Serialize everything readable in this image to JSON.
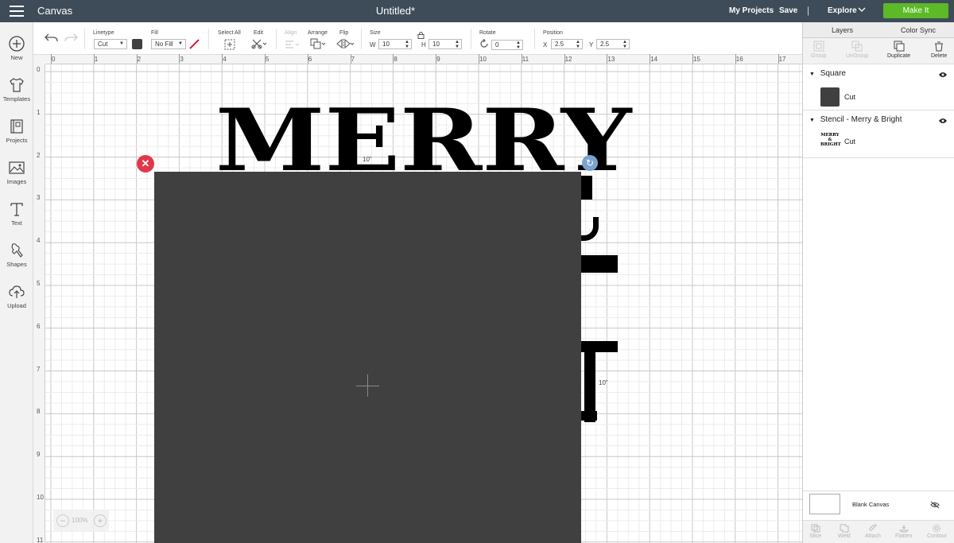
{
  "topbar": {
    "app_name": "Canvas",
    "doc_title": "Untitled*",
    "my_projects": "My Projects",
    "save": "Save",
    "separator": "|",
    "explore": "Explore",
    "make_it": "Make It",
    "make_it_color": "#5cb927"
  },
  "leftbar": {
    "items": [
      {
        "label": "New",
        "icon": "plus-circle-icon"
      },
      {
        "label": "Templates",
        "icon": "shirt-icon"
      },
      {
        "label": "Projects",
        "icon": "projects-icon"
      },
      {
        "label": "Images",
        "icon": "image-icon"
      },
      {
        "label": "Text",
        "icon": "text-icon"
      },
      {
        "label": "Shapes",
        "icon": "shapes-icon"
      },
      {
        "label": "Upload",
        "icon": "upload-cloud-icon"
      }
    ]
  },
  "toolbar": {
    "linetype_label": "Linetype",
    "linetype_value": "Cut",
    "fill_label": "Fill",
    "fill_value": "No Fill",
    "select_all_label": "Select All",
    "edit_label": "Edit",
    "align_label": "Align",
    "arrange_label": "Arrange",
    "flip_label": "Flip",
    "size_label": "Size",
    "w_label": "W",
    "w_value": "10",
    "h_label": "H",
    "h_value": "10",
    "rotate_label": "Rotate",
    "rotate_value": "0",
    "position_label": "Position",
    "x_label": "X",
    "x_value": "2.5",
    "y_label": "Y",
    "y_value": "2.5",
    "swatch_color": "#404040"
  },
  "ruler": {
    "h_ticks": [
      "0",
      "1",
      "2",
      "3",
      "4",
      "5",
      "6",
      "7",
      "8",
      "9",
      "10",
      "11",
      "12",
      "13",
      "14",
      "15",
      "16",
      "17"
    ],
    "v_ticks": [
      "0",
      "1",
      "2",
      "3",
      "4",
      "5",
      "6",
      "7",
      "8",
      "9",
      "10",
      "11"
    ]
  },
  "canvas": {
    "text": "MERRY",
    "dim_width": "10\"",
    "dim_height": "10\"",
    "square_color": "#404040",
    "delete_color": "#e0384a",
    "rotate_color": "#7aa3cf"
  },
  "zoom": {
    "value": "100%",
    "minus": "−",
    "plus": "+"
  },
  "rightpanel": {
    "tabs": [
      "Layers",
      "Color Sync"
    ],
    "actions": [
      {
        "label": "Group",
        "enabled": false
      },
      {
        "label": "UnGroup",
        "enabled": false
      },
      {
        "label": "Duplicate",
        "enabled": true
      },
      {
        "label": "Delete",
        "enabled": true
      }
    ],
    "layers": [
      {
        "name": "Square",
        "operation": "Cut"
      },
      {
        "name": "Stencil - Merry & Bright",
        "operation": "Cut",
        "thumb_text": [
          "MERRY",
          "&",
          "BRIGHT"
        ]
      }
    ],
    "blank_canvas": "Blank Canvas",
    "bottom_actions": [
      "Slice",
      "Weld",
      "Attach",
      "Flatten",
      "Contour"
    ]
  }
}
